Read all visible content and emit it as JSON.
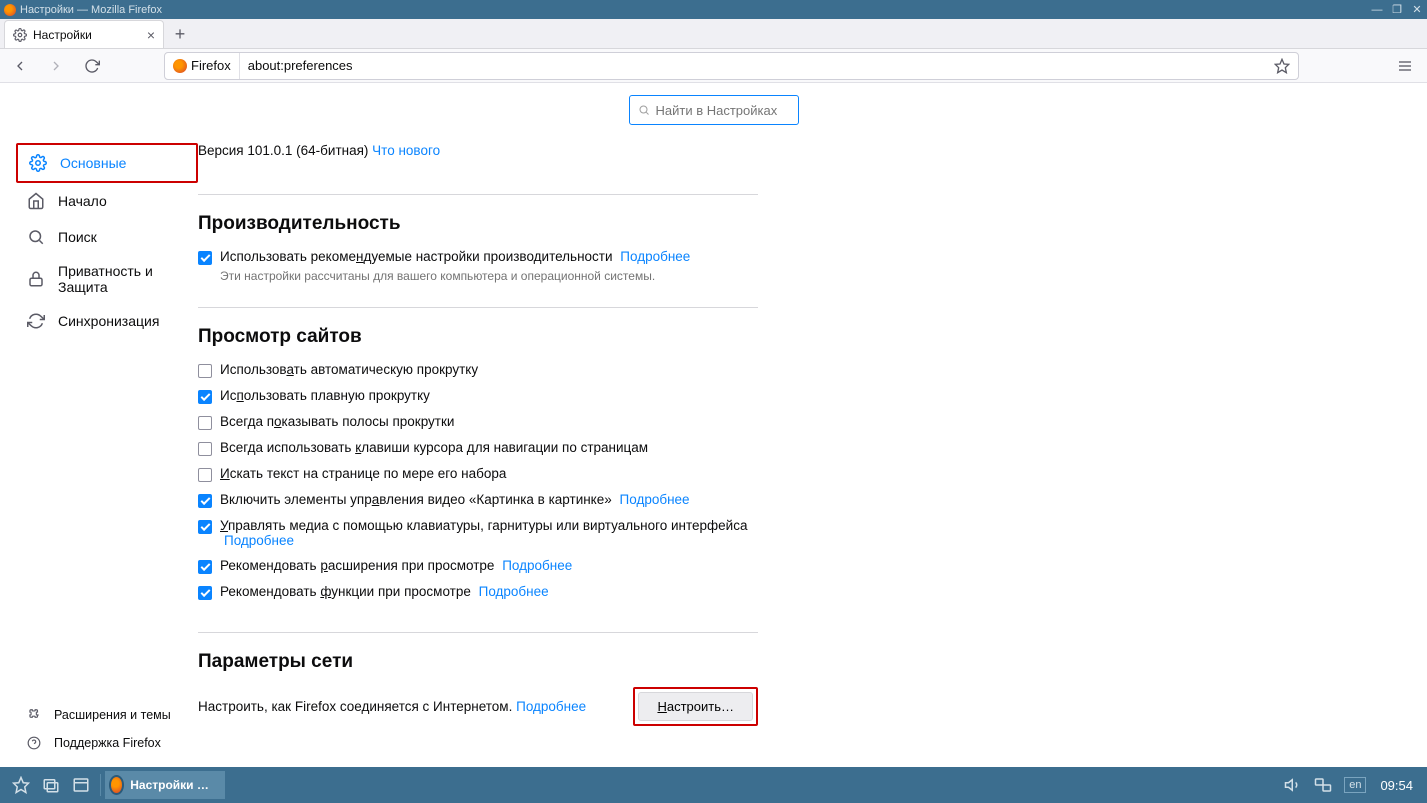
{
  "window": {
    "title": "Настройки — Mozilla Firefox"
  },
  "tabs": {
    "active": {
      "label": "Настройки"
    }
  },
  "urlbar": {
    "identity": "Firefox",
    "url": "about:preferences"
  },
  "search": {
    "placeholder": "Найти в Настройках"
  },
  "sidebar": {
    "items": [
      {
        "label": "Основные"
      },
      {
        "label": "Начало"
      },
      {
        "label": "Поиск"
      },
      {
        "label": "Приватность и Защита"
      },
      {
        "label": "Синхронизация"
      }
    ],
    "extensions": "Расширения и темы",
    "support": "Поддержка Firefox"
  },
  "version": {
    "prefix": "Версия 101.0.1 (64-битная)",
    "whatsnew": "Что нового"
  },
  "performance": {
    "title": "Производительность",
    "recommended_prefix": "Использовать рекоме",
    "recommended_u": "н",
    "recommended_suffix": "дуемые настройки производительности",
    "learn_more": "Подробнее",
    "desc": "Эти настройки рассчитаны для вашего компьютера и операционной системы."
  },
  "browsing": {
    "title": "Просмотр сайтов",
    "items": [
      {
        "checked": false,
        "p": "Использов",
        "u": "а",
        "s": "ть автоматическую прокрутку",
        "link": ""
      },
      {
        "checked": true,
        "p": "Ис",
        "u": "п",
        "s": "ользовать плавную прокрутку",
        "link": ""
      },
      {
        "checked": false,
        "p": "Всегда п",
        "u": "о",
        "s": "казывать полосы прокрутки",
        "link": ""
      },
      {
        "checked": false,
        "p": "Всегда использовать ",
        "u": "к",
        "s": "лавиши курсора для навигации по страницам",
        "link": ""
      },
      {
        "checked": false,
        "p": "",
        "u": "И",
        "s": "скать текст на странице по мере его набора",
        "link": ""
      },
      {
        "checked": true,
        "p": "Включить элементы упр",
        "u": "а",
        "s": "вления видео «Картинка в картинке»",
        "link": "Подробнее"
      },
      {
        "checked": true,
        "p": "",
        "u": "У",
        "s": "правлять медиа с помощью клавиатуры, гарнитуры или виртуального интерфейса",
        "link": "Подробнее"
      },
      {
        "checked": true,
        "p": "Рекомендовать ",
        "u": "р",
        "s": "асширения при просмотре",
        "link": "Подробнее"
      },
      {
        "checked": true,
        "p": "Рекомендовать ",
        "u": "ф",
        "s": "ункции при просмотре",
        "link": "Подробнее"
      }
    ]
  },
  "network": {
    "title": "Параметры сети",
    "text": "Настроить, как Firefox соединяется с Интернетом.",
    "learn_more": "Подробнее",
    "button_u": "Н",
    "button_s": "астроить…"
  },
  "taskbar": {
    "task": "Настройки — Mozi…",
    "lang": "en",
    "clock": "09:54"
  }
}
